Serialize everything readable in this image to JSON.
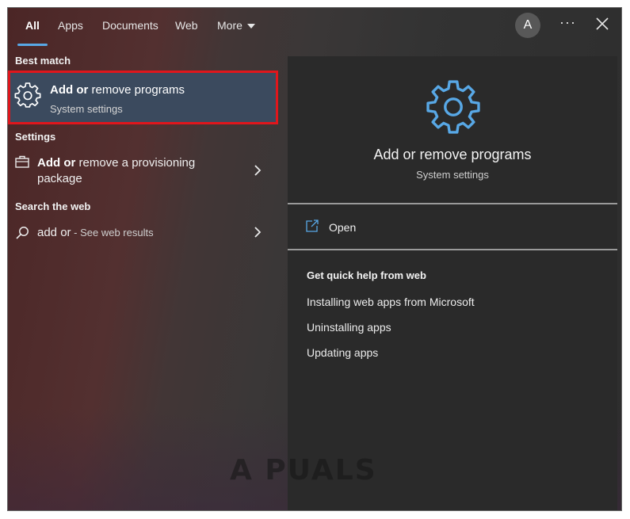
{
  "tabs": [
    {
      "label": "All",
      "active": true
    },
    {
      "label": "Apps"
    },
    {
      "label": "Documents"
    },
    {
      "label": "Web"
    },
    {
      "label": "More"
    }
  ],
  "header": {
    "avatar_letter": "A",
    "more_options": "···"
  },
  "best_match": {
    "section_label": "Best match",
    "title_bold": "Add or",
    "title_rest": " remove programs",
    "subtitle": "System settings",
    "icon": "gear-icon"
  },
  "settings": {
    "section_label": "Settings",
    "item_bold": "Add or",
    "item_rest": " remove a provisioning",
    "item_rest_line2": "package",
    "icon": "briefcase-icon"
  },
  "search_web": {
    "section_label": "Search the web",
    "query": "add or",
    "suffix": " - See web results",
    "icon": "search-icon"
  },
  "preview": {
    "title": "Add or remove programs",
    "subtitle": "System settings",
    "open_label": "Open",
    "help_heading": "Get quick help from web",
    "help_links": [
      "Installing web apps from Microsoft",
      "Uninstalling apps",
      "Updating apps"
    ]
  },
  "watermark": "A PUALS",
  "colors": {
    "accent": "#58a8e6",
    "selection_border": "#e0161c",
    "selection_bg": "#3b4a5e",
    "panel_bg": "#2a2a2a"
  }
}
